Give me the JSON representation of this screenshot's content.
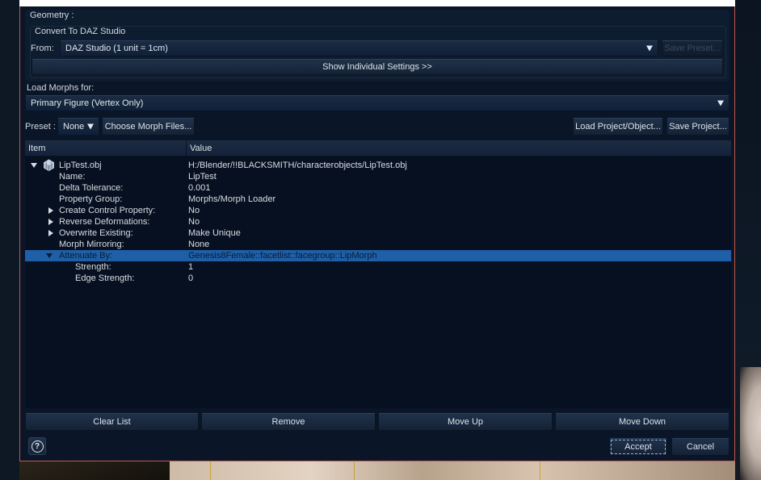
{
  "dialog": {
    "geometry_label": "Geometry :",
    "convert_label": "Convert To DAZ Studio",
    "from_label": "From:",
    "from_value": "DAZ Studio (1 unit = 1cm)",
    "save_preset_label": "Save Preset...",
    "show_settings_label": "Show Individual Settings >>",
    "load_morphs_label": "Load Morphs for:",
    "load_morphs_value": "Primary Figure (Vertex Only)",
    "preset_label": "Preset :",
    "preset_value": "None",
    "choose_files_label": "Choose Morph Files...",
    "load_project_label": "Load Project/Object...",
    "save_project_label": "Save Project..."
  },
  "tree": {
    "col_item": "Item",
    "col_value": "Value",
    "rows": [
      {
        "name": "LipTest.obj",
        "value": "H:/Blender/!!BLACKSMITH/characterobjects/LipTest.obj"
      },
      {
        "name": "Name:",
        "value": "LipTest"
      },
      {
        "name": "Delta Tolerance:",
        "value": "0.001"
      },
      {
        "name": "Property Group:",
        "value": "Morphs/Morph Loader"
      },
      {
        "name": "Create Control Property:",
        "value": "No"
      },
      {
        "name": "Reverse Deformations:",
        "value": "No"
      },
      {
        "name": "Overwrite Existing:",
        "value": "Make Unique"
      },
      {
        "name": "Morph Mirroring:",
        "value": "None"
      },
      {
        "name": "Attenuate By:",
        "value": "Genesis8Female::facetlist::facegroup::LipMorph"
      },
      {
        "name": "Strength:",
        "value": "1"
      },
      {
        "name": "Edge Strength:",
        "value": "0"
      }
    ]
  },
  "actions": {
    "clear": "Clear List",
    "remove": "Remove",
    "move_up": "Move Up",
    "move_down": "Move Down"
  },
  "footer": {
    "help_glyph": "?",
    "accept": "Accept",
    "cancel": "Cancel"
  }
}
